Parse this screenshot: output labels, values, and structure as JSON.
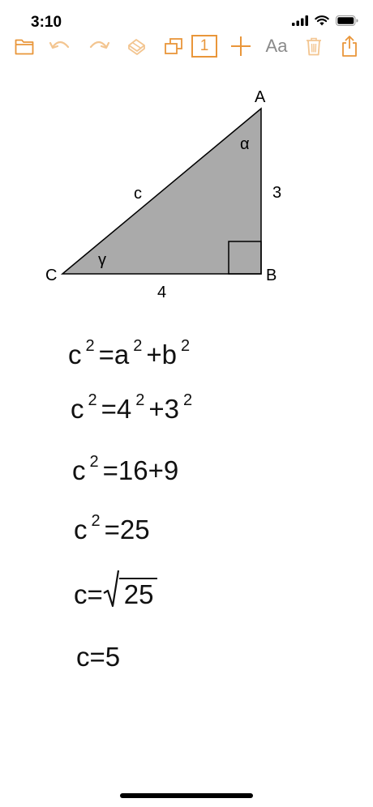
{
  "status_bar": {
    "time": "3:10",
    "icons": [
      "cellular-icon",
      "wifi-icon",
      "battery-icon"
    ]
  },
  "toolbar": {
    "accent_color": "#e9963a",
    "disabled_color": "#f3c590",
    "items": [
      "folder-icon",
      "undo-icon",
      "redo-icon",
      "eraser-icon",
      "duplicate-page-icon",
      "page-number",
      "add-icon",
      "font-button",
      "trash-icon",
      "share-icon"
    ],
    "page_number": "1",
    "font_label": "Aa"
  },
  "triangle": {
    "fill_color": "#aaaaaa",
    "vertices": {
      "A": "A",
      "B": "B",
      "C": "C"
    },
    "sides": {
      "hypotenuse": "c",
      "vertical": "3",
      "horizontal": "4"
    },
    "angles": {
      "alpha": "α",
      "gamma": "γ"
    }
  },
  "equations": {
    "eq1": {
      "lhs": "c",
      "lhs_exp": "2",
      "eq": "=",
      "t1": "a",
      "t1_exp": "2",
      "op": "+",
      "t2": "b",
      "t2_exp": "2"
    },
    "eq2": {
      "lhs": "c",
      "lhs_exp": "2",
      "eq": "=",
      "t1": "4",
      "t1_exp": "2",
      "op": "+",
      "t2": "3",
      "t2_exp": "2"
    },
    "eq3": {
      "lhs": "c",
      "lhs_exp": "2",
      "rhs": "=16+9"
    },
    "eq4": {
      "lhs": "c",
      "lhs_exp": "2",
      "rhs": "=25"
    },
    "eq5": {
      "lhs": "c=",
      "radicand": "25"
    },
    "eq6": {
      "text": "c=5"
    }
  }
}
